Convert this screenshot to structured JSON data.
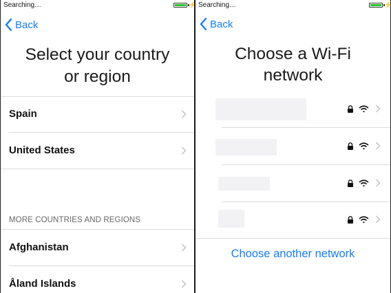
{
  "left": {
    "status_text": "Searching…",
    "back_label": "Back",
    "title_line1": "Select your country",
    "title_line2": "or region",
    "top_countries": [
      "Spain",
      "United States"
    ],
    "section_header": "MORE COUNTRIES AND REGIONS",
    "more_countries": [
      "Afghanistan",
      "Åland Islands"
    ]
  },
  "right": {
    "status_text": "Searching…",
    "back_label": "Back",
    "title_line1": "Choose a Wi-Fi",
    "title_line2": "network",
    "networks_count_visible": 4,
    "choose_another_label": "Choose another network"
  },
  "colors": {
    "accent": "#147efb",
    "battery": "#22c322"
  },
  "icons": [
    "chevron-left-icon",
    "chevron-right-icon",
    "lock-icon",
    "wifi-icon",
    "battery-icon"
  ]
}
